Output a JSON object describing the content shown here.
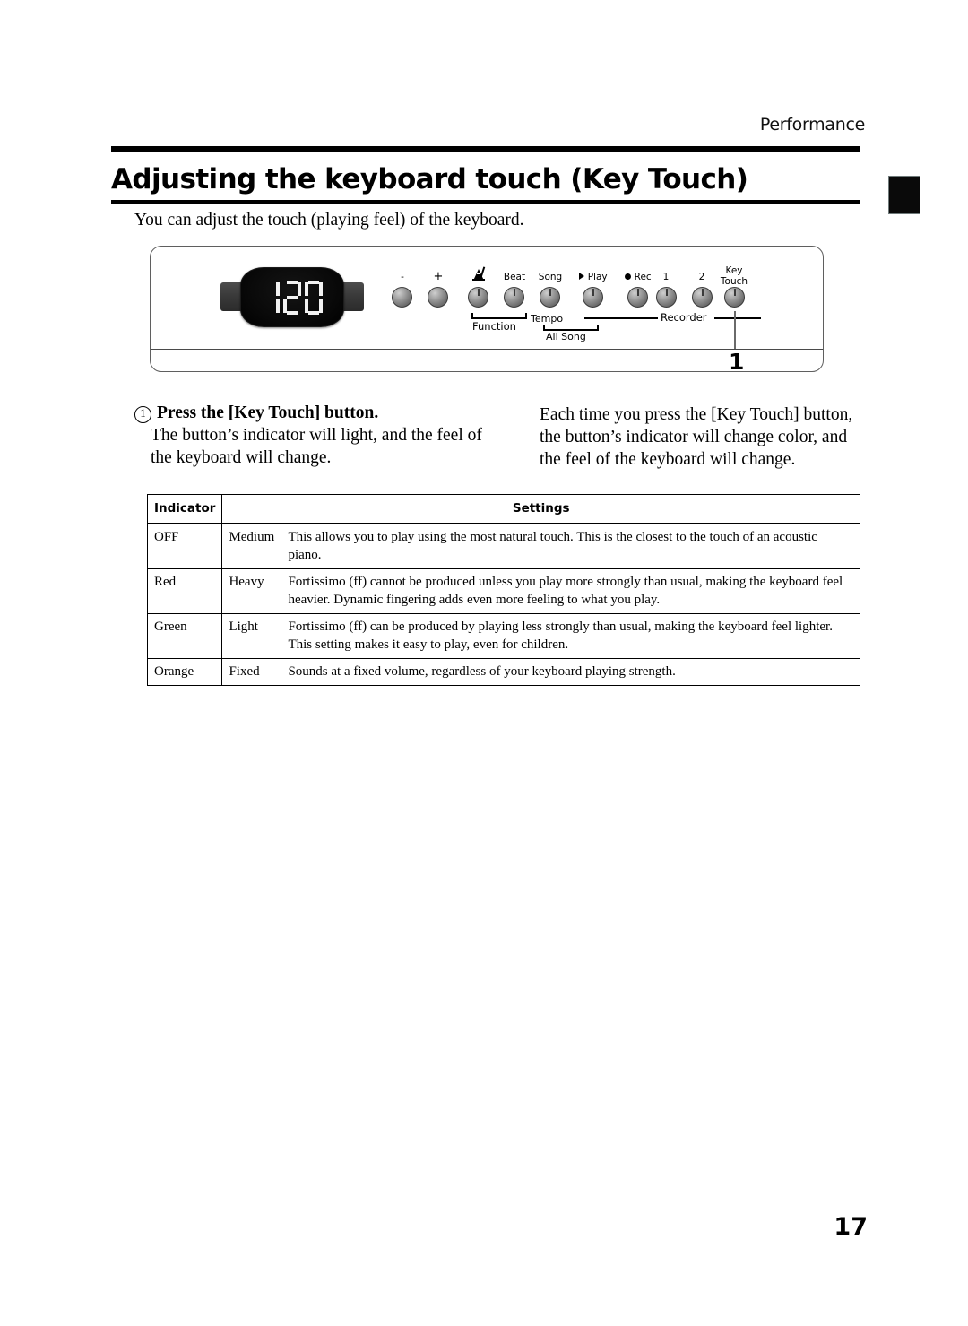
{
  "running_head": "Performance",
  "heading": {
    "title": "Adjusting the keyboard touch (Key Touch)"
  },
  "intro": "You can adjust the touch (playing feel) of the keyboard.",
  "panel": {
    "display_value": "120",
    "callout_number": "1",
    "buttons": [
      {
        "name": "minus",
        "label": "-"
      },
      {
        "name": "plus",
        "label": "+"
      },
      {
        "name": "metronome",
        "label": ""
      },
      {
        "name": "beat",
        "label": "Beat"
      },
      {
        "name": "song",
        "label": "Song"
      },
      {
        "name": "play",
        "label": "Play"
      },
      {
        "name": "rec",
        "label": "Rec"
      },
      {
        "name": "track-1",
        "label": "1"
      },
      {
        "name": "track-2",
        "label": "2"
      },
      {
        "name": "key-touch",
        "label": "Key\nTouch"
      }
    ],
    "key_touch_label_line1": "Key",
    "key_touch_label_line2": "Touch",
    "group_labels": {
      "function": "Function",
      "tempo": "Tempo",
      "all_song": "All Song",
      "recorder": "Recorder"
    }
  },
  "step": {
    "number": "1",
    "heading": "Press the [Key Touch] button.",
    "body": "The button’s indicator will light, and the feel of the keyboard will change.",
    "right_column": "Each time you press the [Key Touch] button, the button’s indicator will change color, and the feel of the keyboard will change."
  },
  "table": {
    "headers": [
      "Indicator",
      "Settings"
    ],
    "rows": [
      {
        "indicator": "OFF",
        "setting": "Medium",
        "description": "This allows you to play using the most natural touch. This is the closest to the touch of an acoustic piano."
      },
      {
        "indicator": "Red",
        "setting": "Heavy",
        "description": "Fortissimo (ff) cannot be produced unless you play more strongly than usual, making the keyboard feel heavier. Dynamic fingering adds even more feeling to what you play."
      },
      {
        "indicator": "Green",
        "setting": "Light",
        "description": "Fortissimo (ff) can be produced by playing less strongly than usual, making the keyboard feel lighter. This setting makes it easy to play, even for children."
      },
      {
        "indicator": "Orange",
        "setting": "Fixed",
        "description": "Sounds at a fixed volume, regardless of your keyboard playing strength."
      }
    ]
  },
  "page_number": "17"
}
